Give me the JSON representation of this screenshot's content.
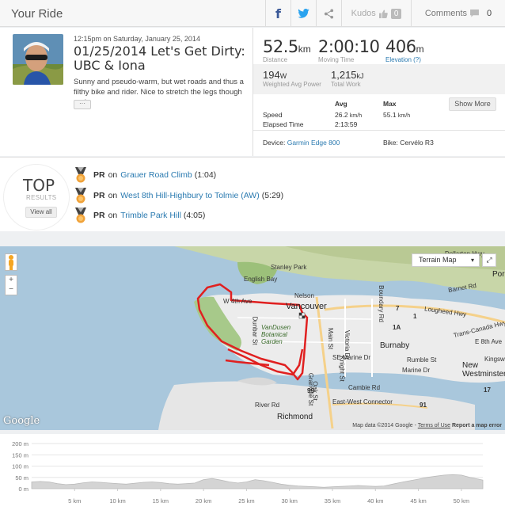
{
  "header": {
    "title": "Your Ride",
    "facebook_glyph": "f",
    "kudos_label": "Kudos",
    "kudos_count": "0",
    "comments_label": "Comments",
    "comments_count": "0"
  },
  "activity": {
    "datetime": "12:15pm on Saturday, January 25, 2014",
    "title": "01/25/2014 Let's Get Dirty: UBC & Iona",
    "description": "Sunny and pseudo-warm, but wet roads and thus a filthy bike and rider. Nice to stretch the legs though and",
    "more_label": "···"
  },
  "stats": {
    "distance": {
      "value": "52.5",
      "unit": "km",
      "label": "Distance"
    },
    "moving_time": {
      "value": "2:00:10",
      "label": "Moving Time"
    },
    "elevation": {
      "value": "406",
      "unit": "m",
      "label": "Elevation (?)"
    },
    "power": {
      "value": "194",
      "unit": "W",
      "label": "Weighted Avg Power"
    },
    "work": {
      "value": "1,215",
      "unit": "kJ",
      "label": "Total Work"
    },
    "table": {
      "col_avg": "Avg",
      "col_max": "Max",
      "speed_label": "Speed",
      "speed_avg": "26.2",
      "speed_avg_unit": "km/h",
      "speed_max": "55.1",
      "speed_max_unit": "km/h",
      "elapsed_label": "Elapsed Time",
      "elapsed_value": "2:13:59"
    },
    "show_more": "Show More",
    "device_label": "Device:",
    "device_value": "Garmin Edge 800",
    "bike_label": "Bike:",
    "bike_value": "Cervélo R3"
  },
  "achievements": {
    "top_label": "TOP",
    "results_label": "RESULTS",
    "view_all": "View all",
    "items": [
      {
        "pr": "PR",
        "on": "on",
        "segment": "Grauer Road Climb",
        "time": "(1:04)"
      },
      {
        "pr": "PR",
        "on": "on",
        "segment": "West 8th Hill-Highbury to Tolmie (AW)",
        "time": "(5:29)"
      },
      {
        "pr": "PR",
        "on": "on",
        "segment": "Trimble Park Hill",
        "time": "(4:05)"
      }
    ]
  },
  "map": {
    "maptype": "Terrain Map",
    "logo": "Google",
    "credit": "Map data ©2014 Google",
    "terms": "Terms of Use",
    "report": "Report a map error",
    "zoom_in": "+",
    "zoom_out": "−",
    "labels": {
      "stanley_park": "Stanley Park",
      "english_bay": "English Bay",
      "vancouver": "Vancouver",
      "vandusen": "VanDusen Botanical Garden",
      "burnaby": "Burnaby",
      "new_westminster": "New Westminster",
      "richmond": "Richmond",
      "lougheed": "Lougheed Hwy",
      "trans_canada": "Trans-Canada Hwy",
      "river_rd": "River Rd",
      "east_west": "East-West Connector",
      "marine_dr": "Marine Dr",
      "w_4th": "W 4th Ave",
      "dollarton": "Dollarton Hwy",
      "barnet": "Barnet Rd",
      "cambie": "Cambie Rd",
      "rumble": "Rumble St",
      "kingsway": "Kingsway",
      "se_marine": "SE Marine Dr",
      "main_st": "Main St",
      "victoria": "Victoria Dr",
      "knight": "Knight St",
      "boundary": "Boundary Rd",
      "oak": "Oak St",
      "granville": "Granville St",
      "dunbar": "Dunbar St",
      "e8th": "E 8th Ave",
      "hwy99": "99",
      "hwy91": "91",
      "hwy1": "1",
      "hwy7": "7",
      "hwy17": "17",
      "hwy1a": "1A",
      "port": "Por",
      "nelson": "Nelson"
    }
  },
  "elevation_chart": {
    "y_ticks": [
      "200 m",
      "150 m",
      "100 m",
      "50 m",
      "0 m"
    ],
    "x_ticks": [
      "5 km",
      "10 km",
      "15 km",
      "20 km",
      "25 km",
      "30 km",
      "35 km",
      "40 km",
      "45 km",
      "50 km"
    ]
  },
  "chart_data": {
    "type": "area",
    "xlabel": "",
    "ylabel": "",
    "ylim": [
      0,
      200
    ],
    "xlim": [
      0,
      52.5
    ],
    "x": [
      0,
      1,
      2,
      3,
      4,
      5,
      6,
      7,
      8,
      9,
      10,
      11,
      12,
      13,
      14,
      15,
      16,
      17,
      18,
      19,
      20,
      21,
      22,
      23,
      24,
      25,
      26,
      27,
      28,
      29,
      30,
      31,
      32,
      33,
      34,
      35,
      36,
      37,
      38,
      39,
      40,
      41,
      42,
      43,
      44,
      45,
      46,
      47,
      48,
      49,
      50,
      51,
      52,
      52.5
    ],
    "values": [
      30,
      32,
      30,
      22,
      18,
      20,
      26,
      30,
      28,
      25,
      22,
      20,
      24,
      28,
      30,
      27,
      22,
      20,
      22,
      25,
      40,
      45,
      38,
      30,
      25,
      30,
      40,
      35,
      28,
      20,
      15,
      12,
      10,
      8,
      6,
      8,
      10,
      12,
      14,
      12,
      10,
      12,
      20,
      28,
      35,
      42,
      50,
      55,
      60,
      62,
      60,
      50,
      42,
      38
    ]
  }
}
